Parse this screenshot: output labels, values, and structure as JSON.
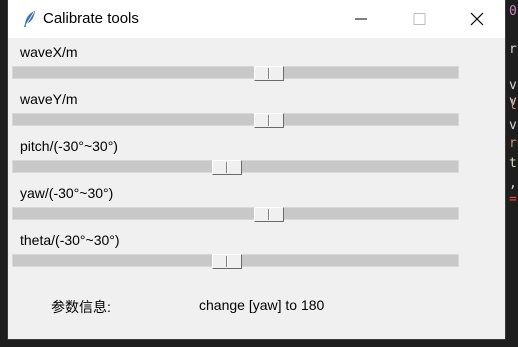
{
  "window": {
    "title": "Calibrate tools",
    "icon": "feather-icon",
    "controls": [
      "minimize-icon",
      "maximize-icon",
      "close-icon"
    ]
  },
  "sliders": [
    {
      "id": "wavex",
      "label": "waveX/m",
      "level": 0.58
    },
    {
      "id": "wavey",
      "label": "waveY/m",
      "level": 0.58
    },
    {
      "id": "pitch",
      "label": "pitch/(-30°~30°)",
      "level": 0.48
    },
    {
      "id": "yaw",
      "label": "yaw/(-30°~30°)",
      "level": 0.58
    },
    {
      "id": "theta",
      "label": "theta/(-30°~30°)",
      "level": 0.48
    }
  ],
  "info": {
    "label": "参数信息:",
    "value": "change [yaw] to 180"
  },
  "background_editor": {
    "glyphs": [
      "0",
      "r",
      "v",
      "v",
      "l",
      "v",
      "r",
      "t",
      ",",
      "="
    ]
  }
}
